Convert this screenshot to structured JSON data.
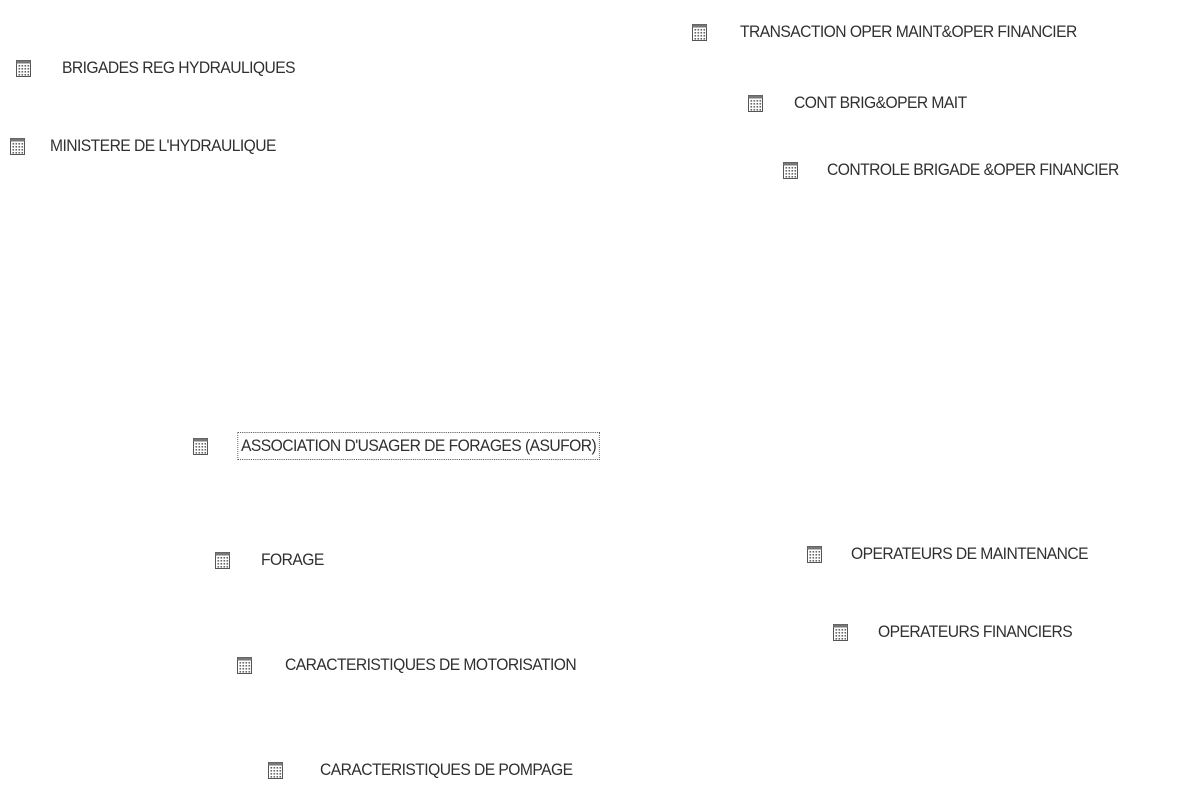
{
  "icon_name": "table-icon",
  "entities": [
    {
      "id": "brigades",
      "label": "BRIGADES REG HYDRAULIQUES",
      "selected": false
    },
    {
      "id": "ministere",
      "label": "MINISTERE DE L'HYDRAULIQUE",
      "selected": false
    },
    {
      "id": "transaction",
      "label": "TRANSACTION OPER MAINT&OPER FINANCIER",
      "selected": false
    },
    {
      "id": "cont-brig",
      "label": "CONT BRIG&OPER MAIT",
      "selected": false
    },
    {
      "id": "controle-brigade",
      "label": "CONTROLE BRIGADE &OPER FINANCIER",
      "selected": false
    },
    {
      "id": "asufor",
      "label": "ASSOCIATION D'USAGER DE FORAGES (ASUFOR)",
      "selected": true
    },
    {
      "id": "forage",
      "label": "FORAGE",
      "selected": false
    },
    {
      "id": "operateurs-maintenance",
      "label": "OPERATEURS DE MAINTENANCE",
      "selected": false
    },
    {
      "id": "operateurs-financiers",
      "label": "OPERATEURS FINANCIERS",
      "selected": false
    },
    {
      "id": "motorisation",
      "label": "CARACTERISTIQUES DE MOTORISATION",
      "selected": false
    },
    {
      "id": "pompage",
      "label": "CARACTERISTIQUES DE POMPAGE",
      "selected": false
    }
  ]
}
